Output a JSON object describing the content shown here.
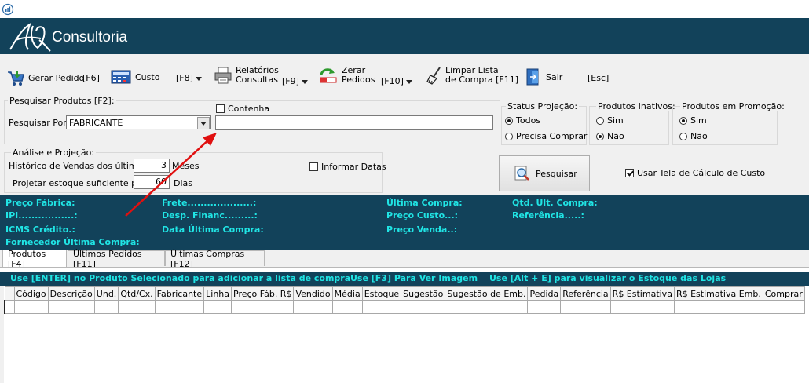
{
  "banner": {
    "title": "Consultoria"
  },
  "toolbar": {
    "gerar_pedido": "Gerar Pedido",
    "gerar_pedido_key": "[F6]",
    "custo": "Custo",
    "custo_key": "[F8]",
    "relatorios_l1": "Relatórios",
    "relatorios_l2": "Consultas",
    "relatorios_key": "[F9]",
    "zerar_l1": "Zerar",
    "zerar_l2": "Pedidos",
    "zerar_key": "[F10]",
    "limpar_l1": "Limpar Lista",
    "limpar_l2": "de Compra [F11]",
    "sair": "Sair",
    "sair_key": "[Esc]"
  },
  "search": {
    "group_label": "Pesquisar Produtos [F2]:",
    "por_label": "Pesquisar Por:",
    "por_value": "FABRICANTE",
    "contenha_label": "Contenha",
    "text_value": ""
  },
  "status_projecao": {
    "label": "Status Projeção:",
    "options": [
      "Todos",
      "Precisa Comprar"
    ],
    "selected": "Todos"
  },
  "produtos_inativos": {
    "label": "Produtos Inativos:",
    "options": [
      "Sim",
      "Não"
    ],
    "selected": "Não"
  },
  "produtos_promocao": {
    "label": "Produtos em Promoção:",
    "options": [
      "Sim",
      "Não"
    ],
    "selected": "Sim"
  },
  "analise": {
    "group_label": "Análise e Projeção:",
    "historico_label": "Histórico de Vendas dos últimos",
    "historico_value": "3",
    "historico_unit": "Meses",
    "projetar_label": "Projetar estoque suficiente para",
    "projetar_value": "60",
    "projetar_unit": "Dias",
    "informar_datas": "Informar Datas"
  },
  "pesquisar_button": "Pesquisar",
  "usar_tela": "Usar Tela de Cálculo de Custo",
  "info": {
    "preco_fabrica": "Preço Fábrica:",
    "ipi": "IPI.................:",
    "icms": "ICMS Crédito.:",
    "fornecedor": "Fornecedor Última Compra:",
    "frete": "Frete....................:",
    "desp_financ": "Desp. Financ.........:",
    "data_ultima": "Data Última Compra:",
    "ultima_compra": "Última Compra:",
    "preco_custo": "Preço Custo...:",
    "preco_venda": "Preço Venda..:",
    "qtd_ult": "Qtd. Ult. Compra:",
    "referencia": "Referência.....:"
  },
  "tabs": [
    "Produtos  [F4]",
    "Últimos Pedidos [F11]",
    "Últimas Compras [F12]"
  ],
  "hints": {
    "h1": "Use [ENTER] no Produto Selecionado para adicionar a lista de compra",
    "h2": "Use [F3] Para Ver Imagem",
    "h3": "Use [Alt + E] para visualizar o Estoque das Lojas"
  },
  "columns": [
    "Código",
    "Descrição",
    "Und.",
    "Qtd/Cx.",
    "Fabricante",
    "Linha",
    "Preço Fáb. R$",
    "Vendido",
    "Média",
    "Estoque",
    "Sugestão",
    "Sugestão de Emb.",
    "Pedida",
    "Referência",
    "R$ Estimativa",
    "R$ Estimativa Emb.",
    "Comprar"
  ],
  "colors": {
    "banner": "#12425a",
    "info_text": "#20e5e5"
  }
}
